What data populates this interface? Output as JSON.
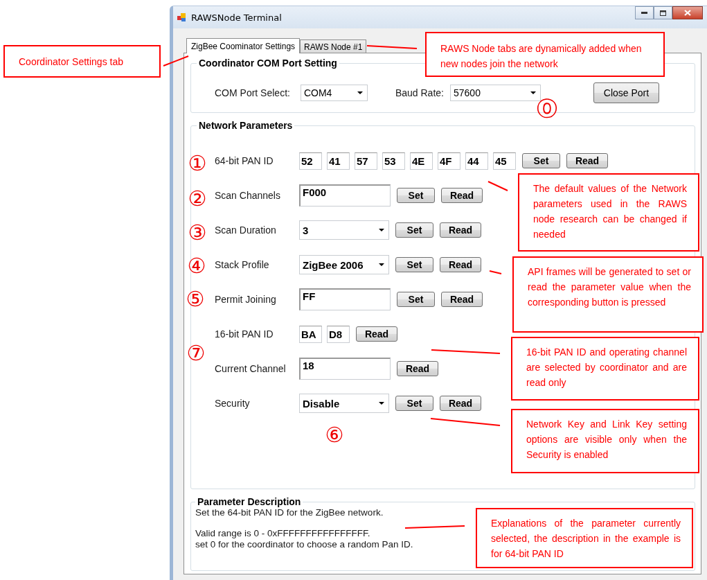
{
  "window": {
    "title": "RAWSNode Terminal"
  },
  "tabs": [
    {
      "label": "ZigBee Coominator Settings",
      "selected": true
    },
    {
      "label": "RAWS Node #1",
      "selected": false
    }
  ],
  "com_port_setting": {
    "title": "Coordinator COM Port Setting",
    "port_label": "COM Port Select:",
    "port": "COM4",
    "baud_label": "Baud Rate:",
    "baud": "57600",
    "button": "Close Port"
  },
  "network_parameters": {
    "title": "Network Parameters",
    "rows": [
      {
        "label": "64-bit PAN ID",
        "kind": "bytes",
        "values": [
          "52",
          "41",
          "57",
          "53",
          "4E",
          "4F",
          "44",
          "45"
        ],
        "buttons": [
          "Set",
          "Read"
        ]
      },
      {
        "label": "Scan Channels",
        "kind": "text",
        "value": "F000",
        "buttons": [
          "Set",
          "Read"
        ]
      },
      {
        "label": "Scan Duration",
        "kind": "dropdown",
        "value": "3",
        "buttons": [
          "Set",
          "Read"
        ]
      },
      {
        "label": "Stack Profile",
        "kind": "dropdown",
        "value": "ZigBee 2006",
        "buttons": [
          "Set",
          "Read"
        ]
      },
      {
        "label": "Permit Joining",
        "kind": "text",
        "value": "FF",
        "buttons": [
          "Set",
          "Read"
        ]
      },
      {
        "label": "16-bit PAN ID",
        "kind": "bytes",
        "values": [
          "BA",
          "D8"
        ],
        "buttons": [
          "Read"
        ]
      },
      {
        "label": "Current Channel",
        "kind": "text",
        "value": "18",
        "buttons": [
          "Read"
        ]
      },
      {
        "label": "Security",
        "kind": "dropdown",
        "value": "Disable",
        "buttons": [
          "Set",
          "Read"
        ]
      }
    ]
  },
  "parameter_description": {
    "title": "Parameter Description",
    "paragraphs": [
      "Set the 64-bit PAN ID for the ZigBee network.",
      "Valid range is 0 - 0xFFFFFFFFFFFFFFFF.\nset 0 for the coordinator to choose a random Pan ID."
    ]
  },
  "annotations": [
    {
      "text": "Coordinator Settings tab"
    },
    {
      "text": "RAWS Node tabs are dynamically added when new nodes join the network"
    },
    {
      "text": "The default values of the Network parameters used in the RAWS node research can be changed if needed"
    },
    {
      "text": "API frames will be generated to set or read the parameter value when the corresponding button is pressed"
    },
    {
      "text": "16-bit PAN ID and operating channel are selected by coordinator and are read only"
    },
    {
      "text": "Network Key and Link Key setting options are visible only when the Security is enabled"
    },
    {
      "text": "Explanations of the parameter currently selected, the description in the example is for 64-bit PAN ID"
    }
  ],
  "markers": [
    "⓪",
    "①",
    "②",
    "③",
    "④",
    "⑤",
    "⑦",
    "⑥"
  ]
}
